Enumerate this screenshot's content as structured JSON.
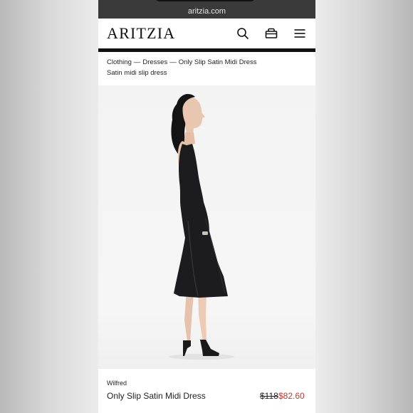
{
  "browser": {
    "url": "aritzia.com"
  },
  "header": {
    "logo": "ARITZIA",
    "icons": [
      "search-icon",
      "bag-icon",
      "menu-icon"
    ]
  },
  "breadcrumb": {
    "items": [
      "Clothing",
      "Dresses",
      "Only Slip Satin Midi Dress"
    ],
    "separator": "—"
  },
  "product": {
    "subtitle": "Satin midi slip dress",
    "brand": "Wilfred",
    "name": "Only Slip Satin Midi Dress",
    "original_price": "$118",
    "sale_price": "$82.60"
  },
  "colors": {
    "sale_price": "#c0392b",
    "dress": "#1c1c1e",
    "header_rule": "#111111"
  }
}
